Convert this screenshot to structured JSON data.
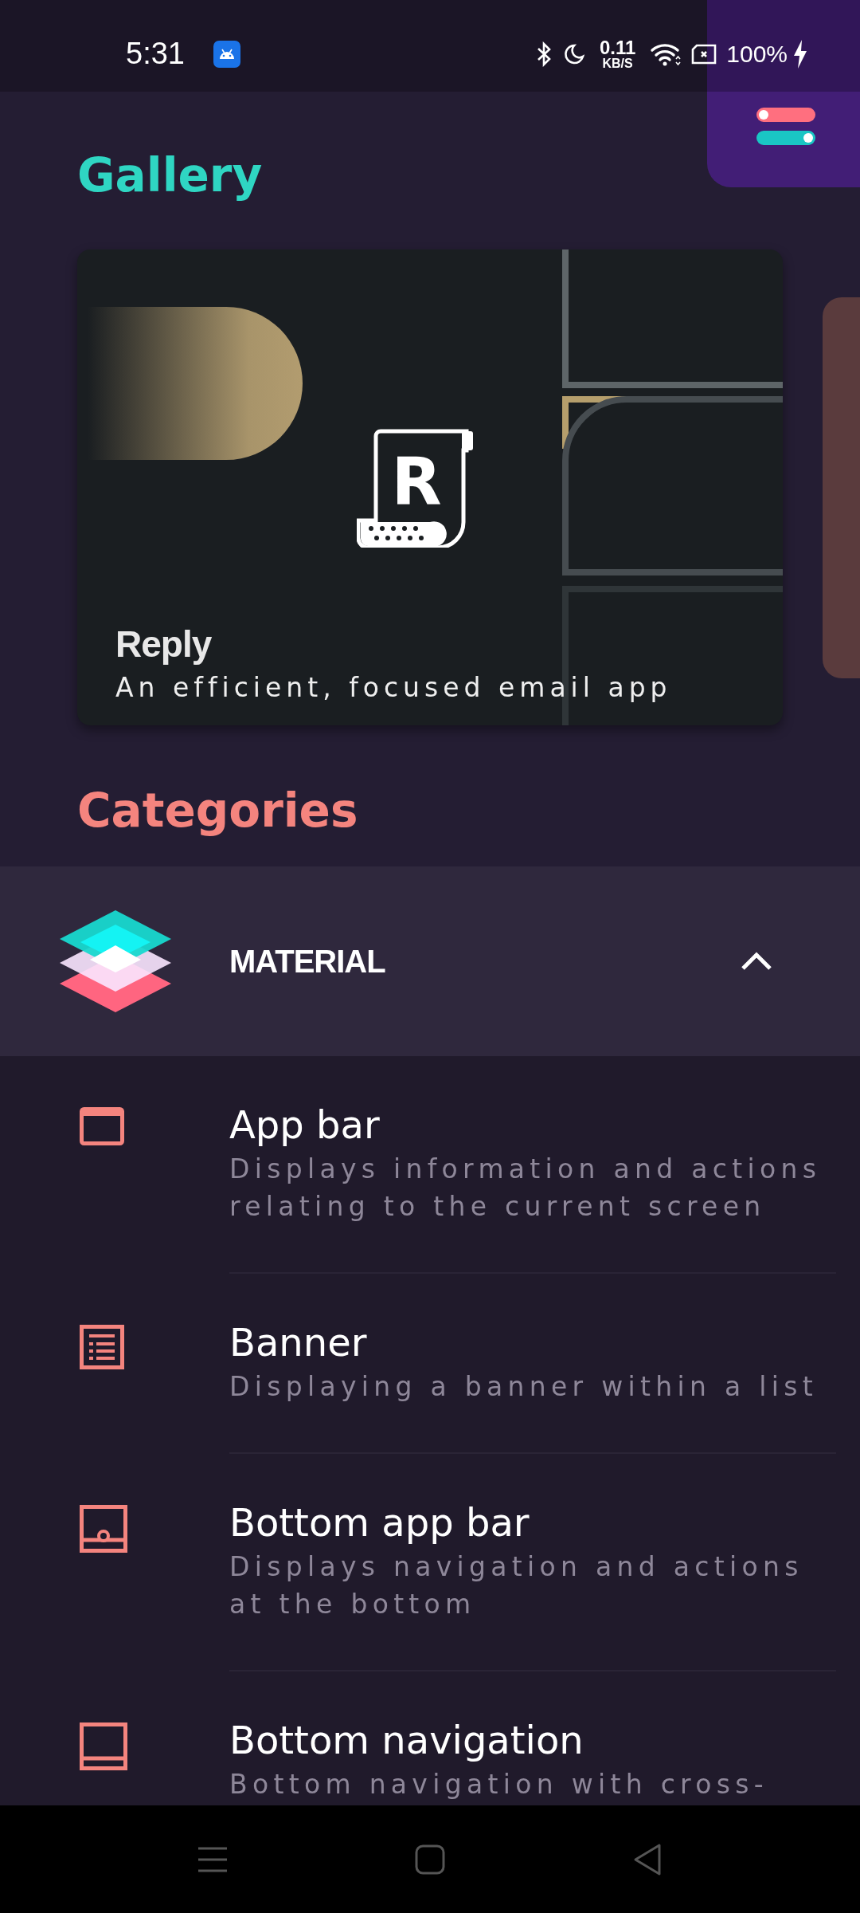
{
  "status_bar": {
    "time": "5:31",
    "net_speed": "0.11",
    "net_unit": "KB/S",
    "battery": "100%"
  },
  "gallery": {
    "title": "Gallery",
    "cards": [
      {
        "logo_letter": "R",
        "title": "Reply",
        "subtitle": "An efficient, focused email app"
      }
    ]
  },
  "categories": {
    "title": "Categories",
    "section": {
      "label": "MATERIAL",
      "expanded": true
    },
    "items": [
      {
        "title": "App bar",
        "description": "Displays information and actions relating to the current screen"
      },
      {
        "title": "Banner",
        "description": "Displaying a banner within a list"
      },
      {
        "title": "Bottom app bar",
        "description": "Displays navigation and actions at the bottom"
      },
      {
        "title": "Bottom navigation",
        "description": "Bottom navigation with cross-"
      }
    ]
  }
}
